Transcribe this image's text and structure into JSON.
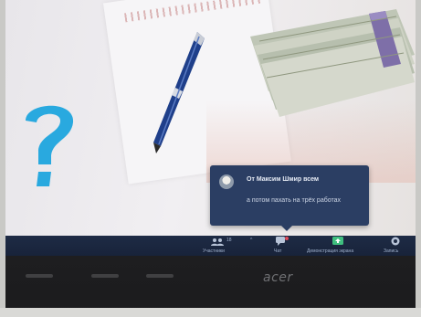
{
  "chat_popup": {
    "sender": "От Максим Шмир всем",
    "message": "а потом пахать на трёх работах"
  },
  "toolbar": {
    "participants_label": "Участники",
    "participants_count": "18",
    "chat_label": "Чат",
    "share_label": "Демонстрация экрана",
    "record_label": "Запись"
  },
  "device": {
    "brand": "acer"
  },
  "colors": {
    "popup_bg": "#2b3e63",
    "toolbar_bg": "#1e2b45",
    "accent_cyan": "#29a9df",
    "share_green": "#3fbf7f"
  }
}
